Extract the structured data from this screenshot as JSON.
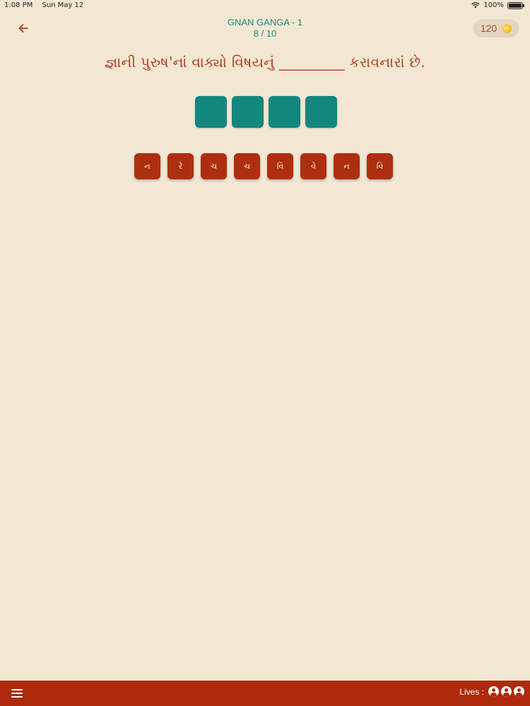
{
  "status_bar": {
    "time": "1:08 PM",
    "date": "Sun May 12",
    "battery": "100%"
  },
  "header": {
    "title": "GNAN GANGA - 1",
    "progress": "8 / 10",
    "back_icon": "arrow-left-icon",
    "coins": "120",
    "coin_icon": "coin-icon"
  },
  "question": {
    "text": "જ્ઞાની પુરુષ'નાં વાક્યો વિષયનું _________ કરાવનારાં છે."
  },
  "answer_slots": {
    "count": 4,
    "color": "#13877e"
  },
  "letter_tiles": [
    "ન",
    "રે",
    "ચ",
    "ચ",
    "વિ",
    "વે",
    "ન",
    "વિ"
  ],
  "bottom_bar": {
    "menu_icon": "hamburger-menu-icon",
    "lives_label": "Lives :",
    "lives": 3,
    "life_icon": "user-circle-icon"
  },
  "colors": {
    "background": "#f2e7d3",
    "accent_teal": "#1a8a82",
    "accent_red": "#ad2f10",
    "question_text": "#b63a1f"
  }
}
